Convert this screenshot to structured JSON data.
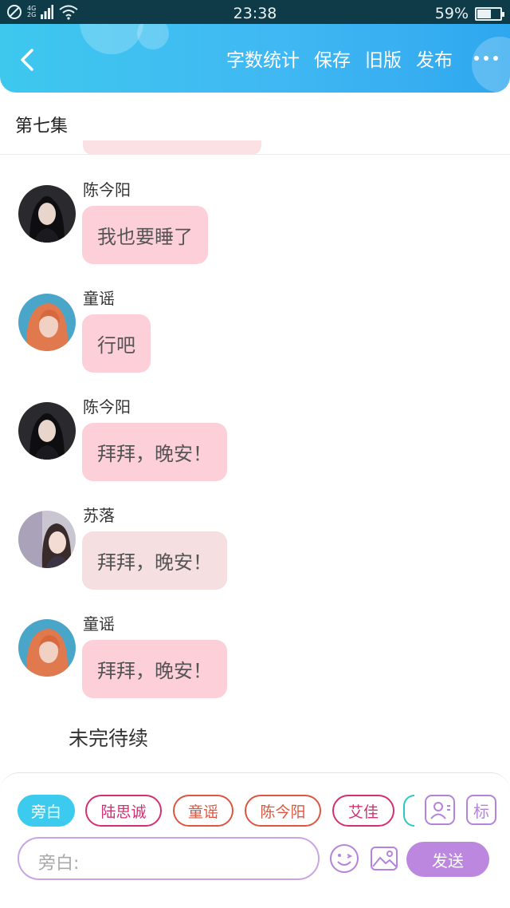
{
  "status_bar": {
    "network_top": "4G",
    "network_bottom": "2G",
    "time": "23:38",
    "battery": "59%",
    "battery_level": 0.59
  },
  "header": {
    "back_icon": "chevron-left-icon",
    "actions": [
      "字数统计",
      "保存",
      "旧版",
      "发布"
    ],
    "more_icon": "more-dots-icon",
    "color": "#40b8f3"
  },
  "episode": {
    "title": "第七集"
  },
  "messages": [
    {
      "sender": "陈今阳",
      "text": "我也要睡了",
      "bubble_color": "#fdd0d9"
    },
    {
      "sender": "童谣",
      "text": "行吧",
      "bubble_color": "#fdd0d9"
    },
    {
      "sender": "陈今阳",
      "text": "拜拜，晚安！",
      "bubble_color": "#fdd0d9"
    },
    {
      "sender": "苏落",
      "text": "拜拜，晚安！",
      "bubble_color": "#f5dfe0"
    },
    {
      "sender": "童谣",
      "text": "拜拜，晚安！",
      "bubble_color": "#fdd0d9"
    }
  ],
  "end_note": "未完待续",
  "composer": {
    "chips": [
      "旁白",
      "陆思诚",
      "童谣",
      "陈今阳",
      "艾佳"
    ],
    "active_chip": "旁白",
    "role_icon": "person-card-icon",
    "tag_button": "标",
    "placeholder": "旁白:",
    "emoji_icon": "emoji-icon",
    "image_icon": "image-icon",
    "send_label": "发送",
    "accent_color": "#bb87df"
  }
}
